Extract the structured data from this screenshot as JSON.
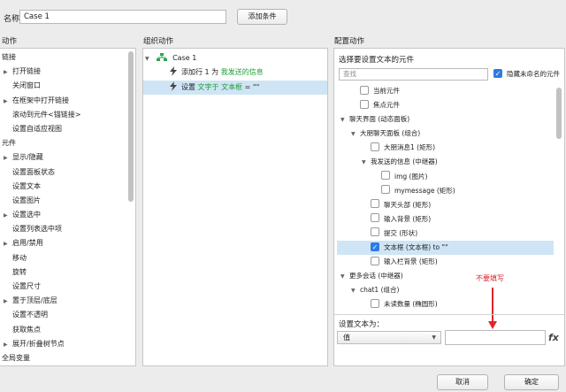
{
  "header": {
    "name_label": "名称",
    "case_name": "Case 1",
    "add_condition_button": "添加条件"
  },
  "actions_panel": {
    "title": "动作",
    "items": [
      {
        "label": "链接",
        "level": 0,
        "expander": false
      },
      {
        "label": "打开链接",
        "level": 1,
        "expander": true
      },
      {
        "label": "关闭窗口",
        "level": 1,
        "expander": false
      },
      {
        "label": "在框架中打开链接",
        "level": 1,
        "expander": true
      },
      {
        "label": "滚动到元件<锚链接>",
        "level": 1,
        "expander": false
      },
      {
        "label": "设置自适应视图",
        "level": 1,
        "expander": false
      },
      {
        "label": "元件",
        "level": 0,
        "expander": false
      },
      {
        "label": "显示/隐藏",
        "level": 1,
        "expander": true
      },
      {
        "label": "设置面板状态",
        "level": 1,
        "expander": false
      },
      {
        "label": "设置文本",
        "level": 1,
        "expander": false
      },
      {
        "label": "设置图片",
        "level": 1,
        "expander": false
      },
      {
        "label": "设置选中",
        "level": 1,
        "expander": true
      },
      {
        "label": "设置列表选中项",
        "level": 1,
        "expander": false
      },
      {
        "label": "启用/禁用",
        "level": 1,
        "expander": true
      },
      {
        "label": "移动",
        "level": 1,
        "expander": false
      },
      {
        "label": "旋转",
        "level": 1,
        "expander": false
      },
      {
        "label": "设置尺寸",
        "level": 1,
        "expander": false
      },
      {
        "label": "置于顶层/底层",
        "level": 1,
        "expander": true
      },
      {
        "label": "设置不透明",
        "level": 1,
        "expander": false
      },
      {
        "label": "获取焦点",
        "level": 1,
        "expander": false
      },
      {
        "label": "展开/折叠树节点",
        "level": 1,
        "expander": true
      },
      {
        "label": "全局变量",
        "level": 0,
        "expander": false
      }
    ]
  },
  "organize_panel": {
    "title": "组织动作",
    "case_label": "Case 1",
    "case_icon": "case-icon",
    "actions": [
      {
        "prefix": "添加行 1 为 ",
        "target": "我发送的信息",
        "selected": false
      },
      {
        "prefix": "设置 ",
        "target": "文字于 文本框",
        "suffix": " = \"\"",
        "selected": true
      }
    ],
    "action_icon": "lightning-icon"
  },
  "config_panel": {
    "title": "配置动作",
    "select_label": "选择要设置文本的元件",
    "search_placeholder": "查找",
    "hide_unnamed_label": "隐藏未命名的元件",
    "hide_unnamed_checked": true,
    "tree": [
      {
        "label": "当前元件",
        "level": 1,
        "checkbox": true,
        "checked": false,
        "expander": false
      },
      {
        "label": "焦点元件",
        "level": 1,
        "checkbox": true,
        "checked": false,
        "expander": false
      },
      {
        "label": "聊天界面 (动态面板)",
        "level": 0,
        "checkbox": false,
        "checked": false,
        "expander": true
      },
      {
        "label": "大朋聊天面板 (组合)",
        "level": 1,
        "checkbox": false,
        "checked": false,
        "expander": true
      },
      {
        "label": "大朋消息1 (矩形)",
        "level": 2,
        "checkbox": true,
        "checked": false,
        "expander": false
      },
      {
        "label": "我发送的信息 (中继器)",
        "level": 2,
        "checkbox": false,
        "checked": false,
        "expander": true
      },
      {
        "label": "img (图片)",
        "level": 3,
        "checkbox": true,
        "checked": false,
        "expander": false
      },
      {
        "label": "mymessage (矩形)",
        "level": 3,
        "checkbox": true,
        "checked": false,
        "expander": false
      },
      {
        "label": "聊天头部 (矩形)",
        "level": 2,
        "checkbox": true,
        "checked": false,
        "expander": false
      },
      {
        "label": "输入背景 (矩形)",
        "level": 2,
        "checkbox": true,
        "checked": false,
        "expander": false
      },
      {
        "label": "提交 (形状)",
        "level": 2,
        "checkbox": true,
        "checked": false,
        "expander": false
      },
      {
        "label": "文本框 (文本框) to \"\"",
        "level": 2,
        "checkbox": true,
        "checked": true,
        "expander": false,
        "selected": true
      },
      {
        "label": "输入栏背景 (矩形)",
        "level": 2,
        "checkbox": true,
        "checked": false,
        "expander": false
      },
      {
        "label": "更多会话 (中继器)",
        "level": 0,
        "checkbox": false,
        "checked": false,
        "expander": true
      },
      {
        "label": "chat1 (组合)",
        "level": 1,
        "checkbox": false,
        "checked": false,
        "expander": true
      },
      {
        "label": "未读数量 (椭圆形)",
        "level": 2,
        "checkbox": true,
        "checked": false,
        "expander": false
      }
    ],
    "annotation": "不要填写",
    "annotation_color": "#e0252b",
    "set_text_label": "设置文本为：",
    "value_type": "值",
    "value_input": "",
    "fx_label": "fx"
  },
  "footer": {
    "cancel_button": "取消",
    "ok_button": "确定"
  }
}
